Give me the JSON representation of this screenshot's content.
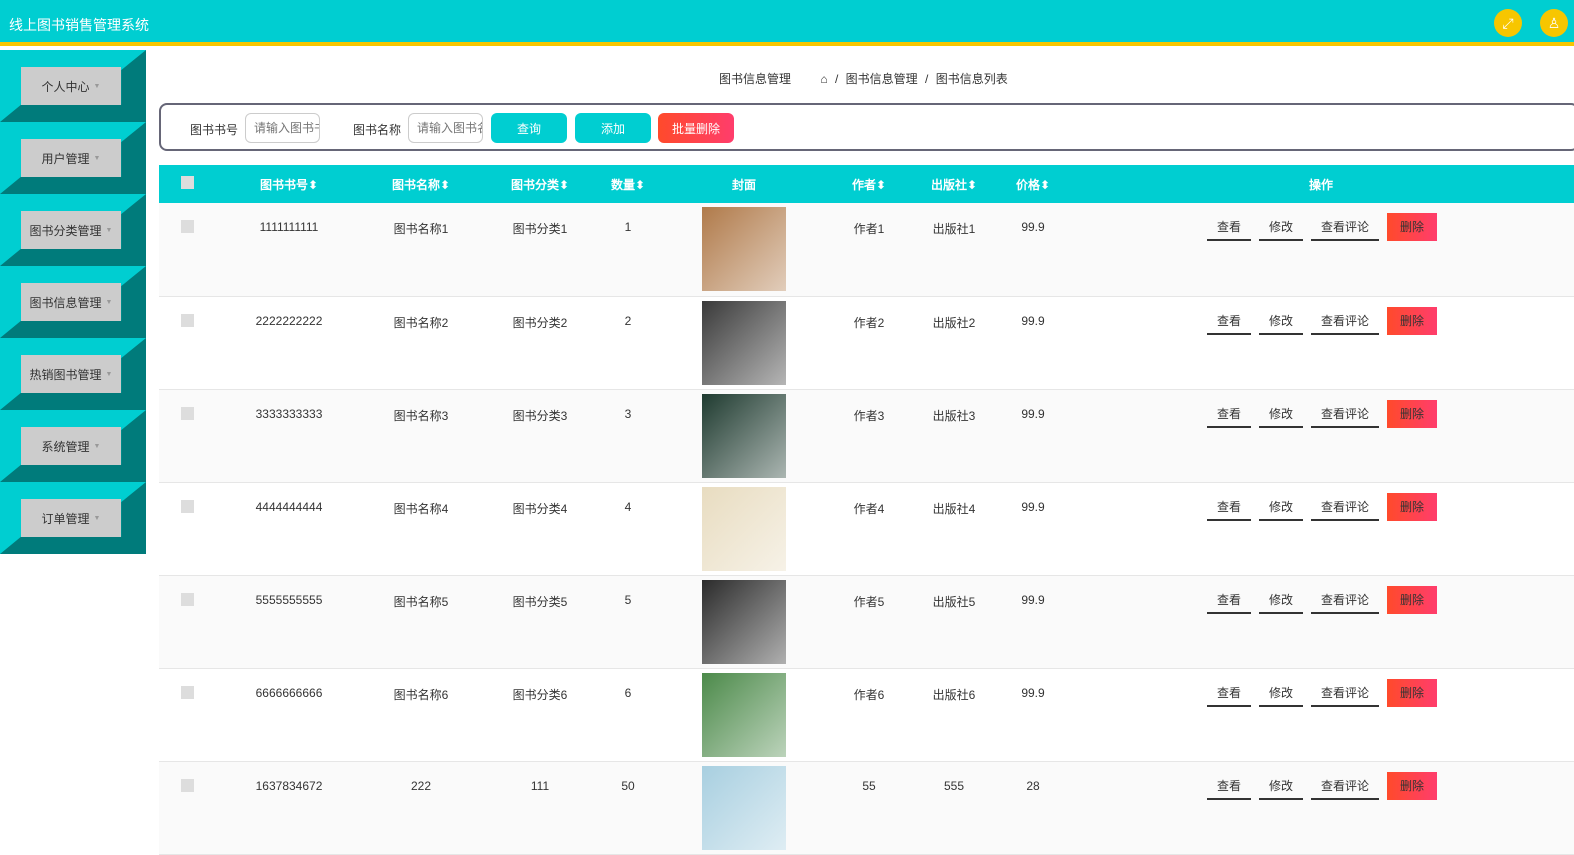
{
  "app": {
    "title": "线上图书销售管理系统",
    "fullscreen_icon": "expand-icon",
    "user_icon": "user-icon",
    "accent": "#00ced1",
    "highlight": "#f7c600"
  },
  "sidebar": {
    "items": [
      {
        "label": "个人中心"
      },
      {
        "label": "用户管理"
      },
      {
        "label": "图书分类管理"
      },
      {
        "label": "图书信息管理"
      },
      {
        "label": "热销图书管理"
      },
      {
        "label": "系统管理"
      },
      {
        "label": "订单管理"
      }
    ]
  },
  "breadcrumb": {
    "page": "图书信息管理",
    "path1": "图书信息管理",
    "path2": "图书信息列表",
    "sep": "/"
  },
  "search": {
    "label_no": "图书书号",
    "placeholder_no": "请输入图书书号",
    "label_name": "图书名称",
    "placeholder_name": "请输入图书名称",
    "query": "查询",
    "add": "添加",
    "batch_delete": "批量删除"
  },
  "table": {
    "headers": {
      "no": "图书书号",
      "name": "图书名称",
      "category": "图书分类",
      "qty": "数量",
      "cover": "封面",
      "author": "作者",
      "publisher": "出版社",
      "price": "价格",
      "ops": "操作"
    },
    "sort_icon": "⬍",
    "actions": {
      "view": "查看",
      "edit": "修改",
      "comments": "查看评论",
      "delete": "删除"
    },
    "rows": [
      {
        "no": "1111111111",
        "name": "图书名称1",
        "category": "图书分类1",
        "qty": "1",
        "author": "作者1",
        "publisher": "出版社1",
        "price": "99.9",
        "cover_color": "#b07a4a"
      },
      {
        "no": "2222222222",
        "name": "图书名称2",
        "category": "图书分类2",
        "qty": "2",
        "author": "作者2",
        "publisher": "出版社2",
        "price": "99.9",
        "cover_color": "#3a3a3a"
      },
      {
        "no": "3333333333",
        "name": "图书名称3",
        "category": "图书分类3",
        "qty": "3",
        "author": "作者3",
        "publisher": "出版社3",
        "price": "99.9",
        "cover_color": "#1f3b30"
      },
      {
        "no": "4444444444",
        "name": "图书名称4",
        "category": "图书分类4",
        "qty": "4",
        "author": "作者4",
        "publisher": "出版社4",
        "price": "99.9",
        "cover_color": "#e8dcc0"
      },
      {
        "no": "5555555555",
        "name": "图书名称5",
        "category": "图书分类5",
        "qty": "5",
        "author": "作者5",
        "publisher": "出版社5",
        "price": "99.9",
        "cover_color": "#2b2b2b"
      },
      {
        "no": "6666666666",
        "name": "图书名称6",
        "category": "图书分类6",
        "qty": "6",
        "author": "作者6",
        "publisher": "出版社6",
        "price": "99.9",
        "cover_color": "#4c8a4a"
      },
      {
        "no": "1637834672",
        "name": "222",
        "category": "111",
        "qty": "50",
        "author": "55",
        "publisher": "555",
        "price": "28",
        "cover_color": "#a8cfe0"
      }
    ]
  }
}
